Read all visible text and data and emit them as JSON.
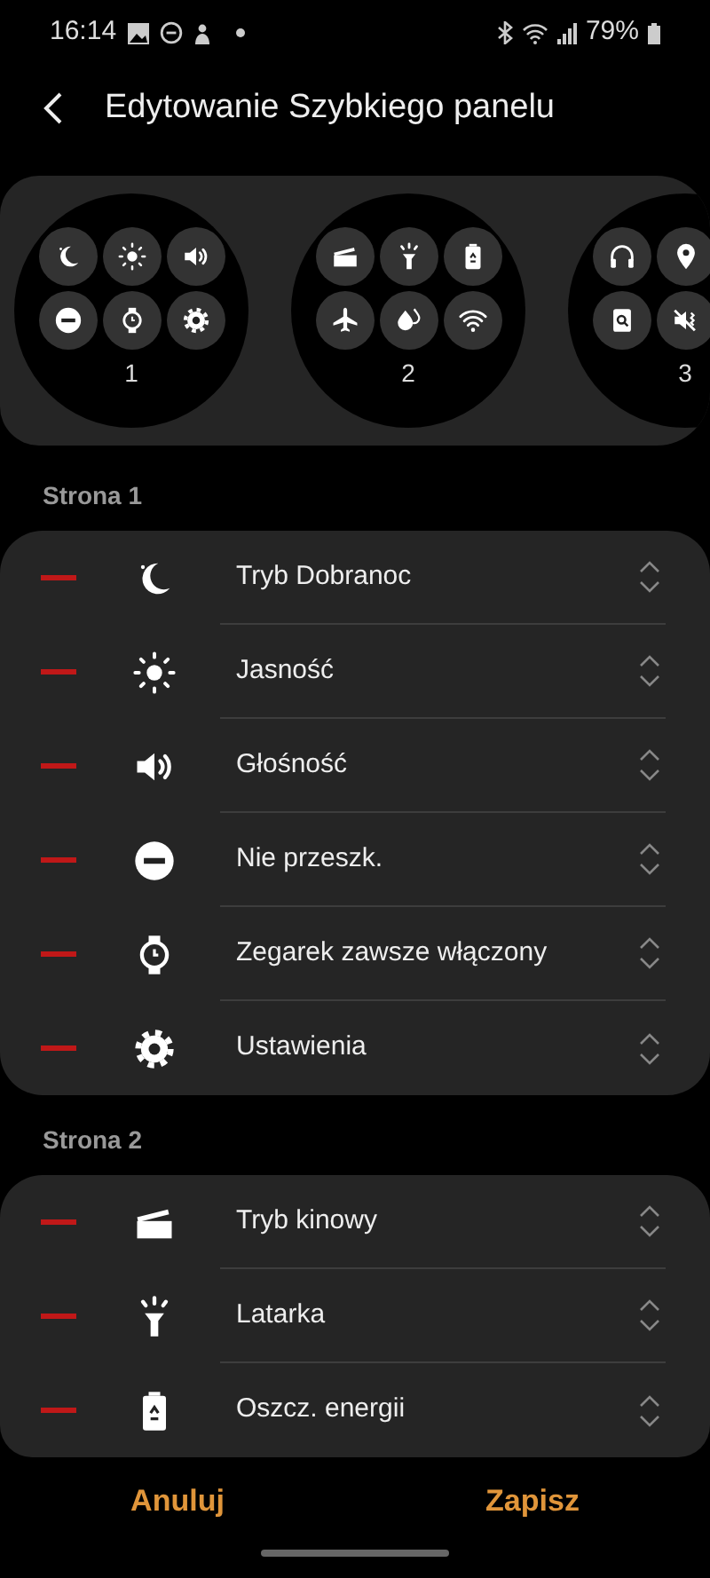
{
  "status_bar": {
    "time": "16:14",
    "battery": "79%"
  },
  "header": {
    "title": "Edytowanie Szybkiego panelu"
  },
  "pages": [
    {
      "number": "1"
    },
    {
      "number": "2"
    },
    {
      "number": "3"
    }
  ],
  "sections": [
    {
      "title": "Strona 1",
      "items": [
        {
          "label": "Tryb Dobranoc"
        },
        {
          "label": "Jasność"
        },
        {
          "label": "Głośność"
        },
        {
          "label": "Nie przeszk."
        },
        {
          "label": "Zegarek zawsze włączony"
        },
        {
          "label": "Ustawienia"
        }
      ]
    },
    {
      "title": "Strona 2",
      "items": [
        {
          "label": "Tryb kinowy"
        },
        {
          "label": "Latarka"
        },
        {
          "label": "Oszcz. energii"
        }
      ]
    }
  ],
  "buttons": [
    {
      "label": "Anuluj"
    },
    {
      "label": "Zapisz"
    }
  ]
}
